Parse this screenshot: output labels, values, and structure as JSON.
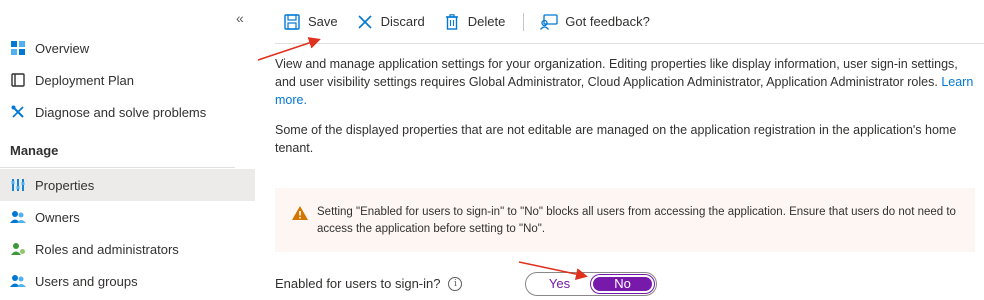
{
  "sidebar": {
    "collapse_glyph": "«",
    "items": [
      {
        "label": "Overview",
        "icon": "overview-grid-icon"
      },
      {
        "label": "Deployment Plan",
        "icon": "book-icon"
      },
      {
        "label": "Diagnose and solve problems",
        "icon": "wrench-icon"
      }
    ],
    "section_title": "Manage",
    "manage_items": [
      {
        "label": "Properties",
        "icon": "properties-sliders-icon",
        "selected": true
      },
      {
        "label": "Owners",
        "icon": "people-icon"
      },
      {
        "label": "Roles and administrators",
        "icon": "roles-icon"
      },
      {
        "label": "Users and groups",
        "icon": "users-groups-icon"
      }
    ]
  },
  "toolbar": {
    "save_label": "Save",
    "discard_label": "Discard",
    "delete_label": "Delete",
    "feedback_label": "Got feedback?"
  },
  "content": {
    "intro_text": "View and manage application settings for your organization. Editing properties like display information, user sign-in settings, and user visibility settings requires Global Administrator, Cloud Application Administrator, Application Administrator roles.",
    "learn_more": "Learn more.",
    "managed_text": "Some of the displayed properties that are not editable are managed on the application registration in the application's home tenant.",
    "warning_text": "Setting \"Enabled for users to sign-in\" to \"No\" blocks all users from accessing the application. Ensure that users do not need to access the application before setting to \"No\".",
    "field_label": "Enabled for users to sign-in?",
    "info_glyph": "i",
    "toggle": {
      "yes": "Yes",
      "no": "No",
      "selected": "No"
    }
  },
  "colors": {
    "accent": "#7719aa",
    "link": "#0078d4",
    "warning": "#d47500",
    "annotation_arrow": "#e0301e"
  }
}
